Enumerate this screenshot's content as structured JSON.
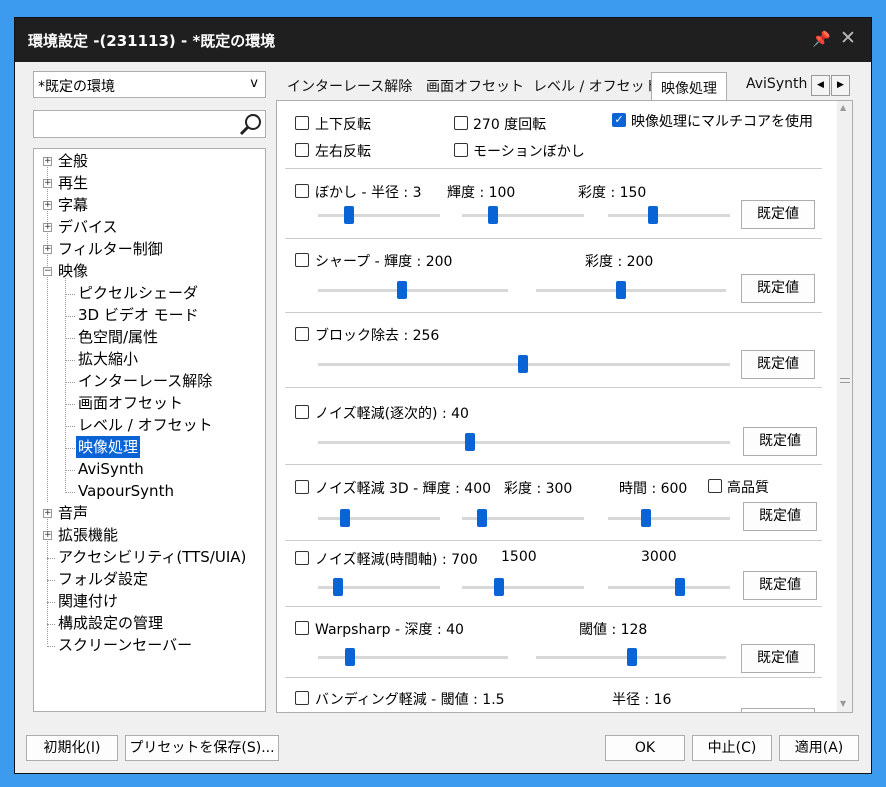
{
  "window": {
    "title": "環境設定 -(231113) - *既定の環境",
    "pin_icon": "pin-icon",
    "close_icon": "close-icon"
  },
  "profile_combo": {
    "value": "*既定の環境"
  },
  "search": {
    "value": ""
  },
  "tree": {
    "items": [
      "全般",
      "再生",
      "字幕",
      "デバイス",
      "フィルター制御",
      "映像",
      "ピクセルシェーダ",
      "3D ビデオ モード",
      "色空間/属性",
      "拡大縮小",
      "インターレース解除",
      "画面オフセット",
      "レベル / オフセット",
      "映像処理",
      "AviSynth",
      "VapourSynth",
      "音声",
      "拡張機能",
      "アクセシビリティ(TTS/UIA)",
      "フォルダ設定",
      "関連付け",
      "構成設定の管理",
      "スクリーンセーバー"
    ],
    "selected": "映像処理"
  },
  "tabs": [
    "インターレース解除",
    "画面オフセット",
    "レベル / オフセット",
    "映像処理",
    "AviSynth"
  ],
  "active_tab": "映像処理",
  "options": {
    "flip_v": "上下反転",
    "flip_h": "左右反転",
    "rotate_270": "270 度回転",
    "motion_blur": "モーションぼかし",
    "multicore": "映像処理にマルチコアを使用",
    "multicore_checked": true
  },
  "sections": {
    "blur": {
      "title": "ぼかし - 半径 : 3",
      "luma": "輝度 : 100",
      "chroma": "彩度 : 150",
      "reset": "既定値"
    },
    "sharpen": {
      "title": "シャープ - 輝度 : 200",
      "chroma": "彩度 : 200",
      "reset": "既定値"
    },
    "deblock": {
      "title": "ブロック除去 : 256",
      "reset": "既定値"
    },
    "noise_seq": {
      "title": "ノイズ軽減(逐次的) : 40",
      "reset": "既定値"
    },
    "noise_3d": {
      "title": "ノイズ軽減 3D  - 輝度 : 400",
      "chroma": "彩度 : 300",
      "time": "時間 : 600",
      "hq": "高品質",
      "reset": "既定値"
    },
    "noise_temporal": {
      "title": "ノイズ軽減(時間軸) : 700",
      "v2": "1500",
      "v3": "3000",
      "reset": "既定値"
    },
    "warpsharp": {
      "title": "Warpsharp - 深度 : 40",
      "threshold": "閾値 : 128",
      "reset": "既定値"
    },
    "debanding": {
      "title": "バンディング軽減 - 閾値 : 1.5",
      "radius": "半径 : 16"
    }
  },
  "footer": {
    "init": "初期化(I)",
    "save_preset": "プリセットを保存(S)...",
    "ok": "OK",
    "cancel": "中止(C)",
    "apply": "適用(A)"
  }
}
